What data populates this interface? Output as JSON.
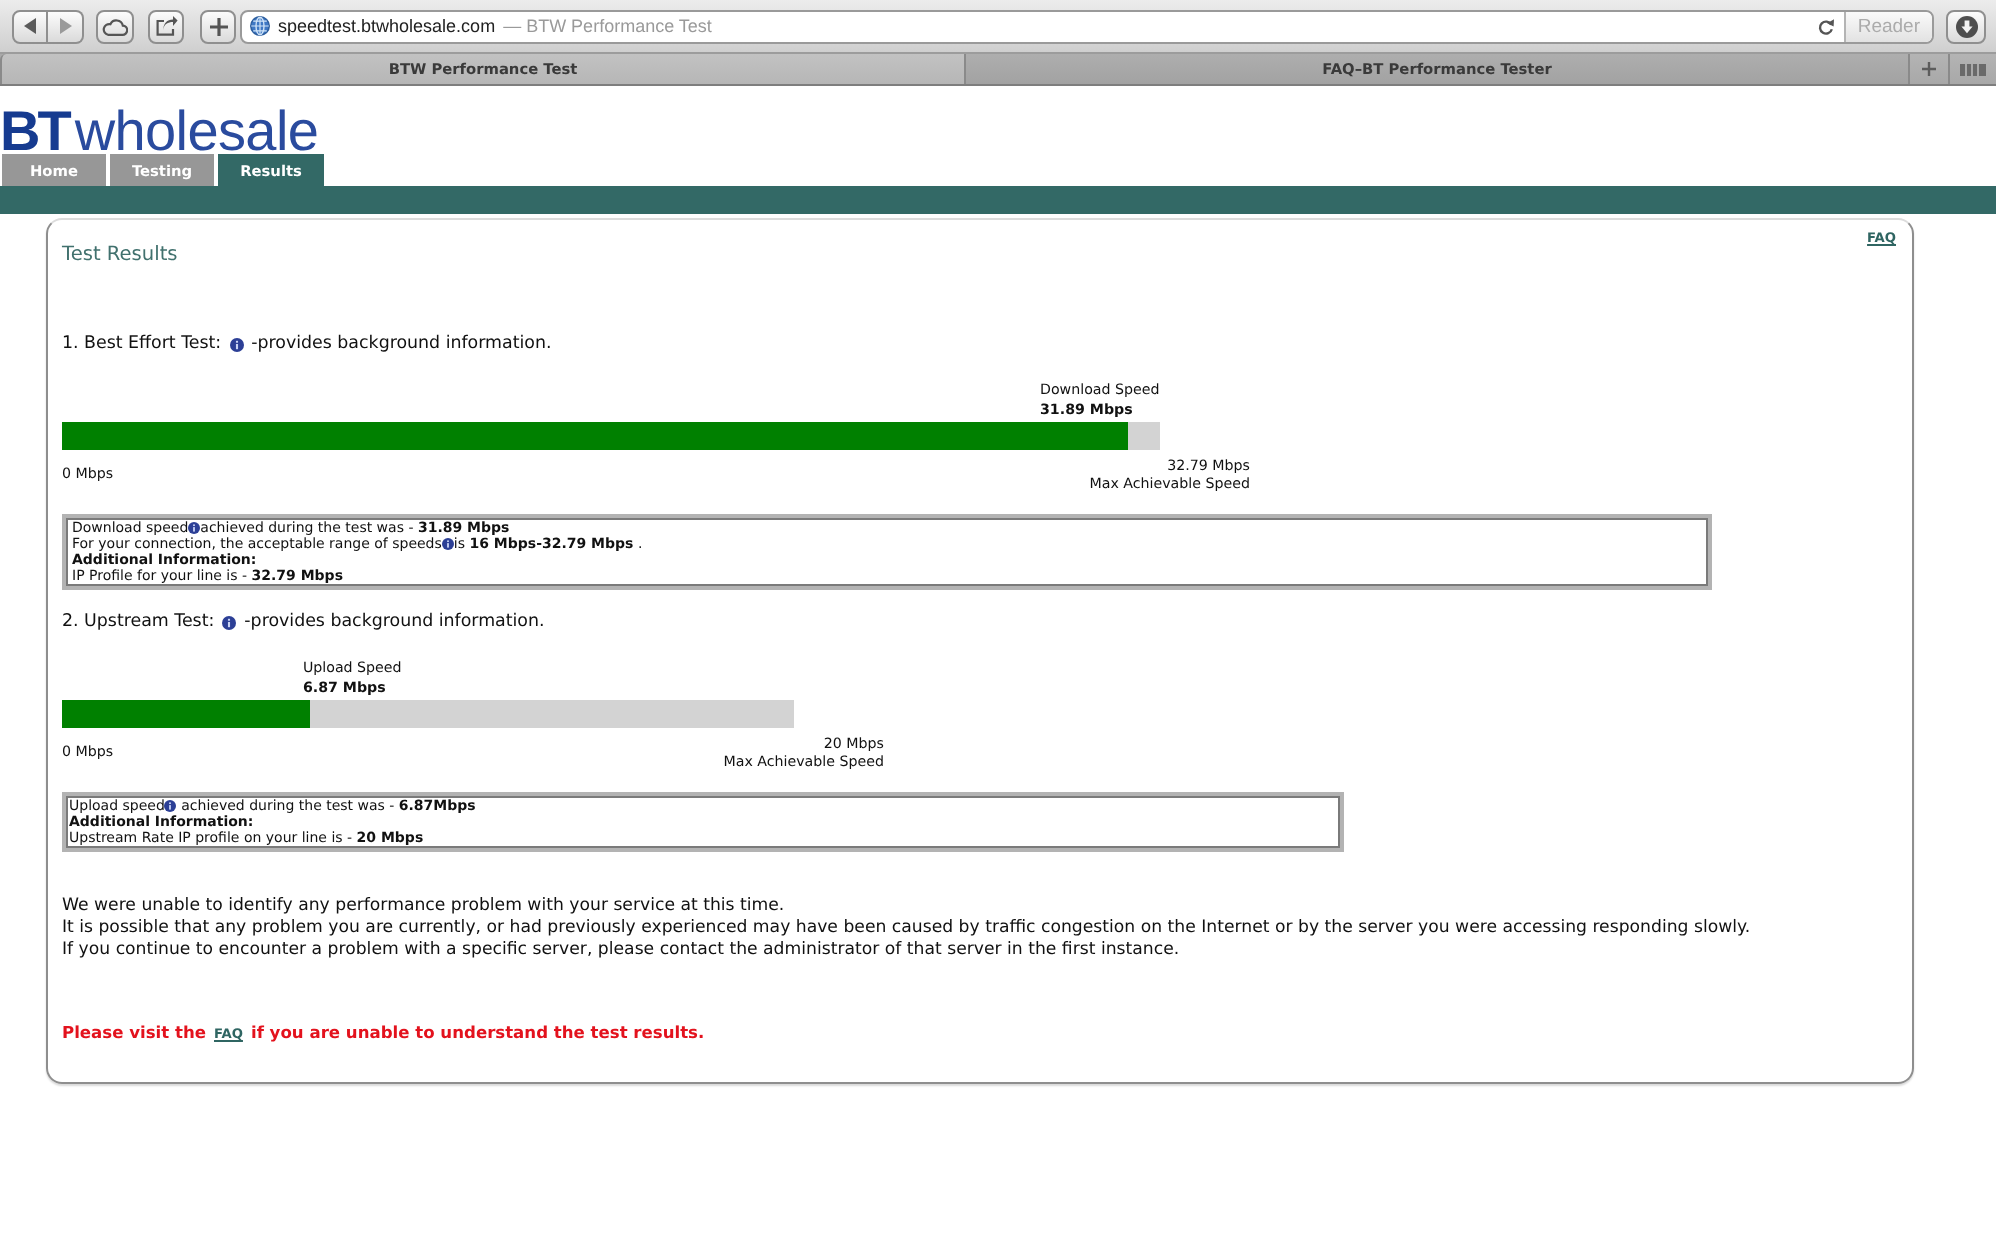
{
  "browser": {
    "address": {
      "url": "speedtest.btwholesale.com",
      "page_title": "— BTW Performance Test"
    },
    "reader_button": "Reader",
    "tabs": [
      {
        "label": "BTW Performance Test",
        "selected": true
      },
      {
        "label": "FAQ–BT Performance Tester",
        "selected": false
      }
    ]
  },
  "header": {
    "logo": "**BT**wholesale",
    "nav": [
      {
        "label": "Home",
        "selected": false
      },
      {
        "label": "Testing",
        "selected": false
      },
      {
        "label": "Results",
        "selected": true
      }
    ]
  },
  "panel": {
    "title": "Test Results",
    "faq_link": "FAQ",
    "tests": [
      {
        "heading": "1. Best Effort Test:",
        "note": "-provides background information.",
        "speed_label": "Download Speed",
        "speed": "31.89 Mbps",
        "level": 0.97,
        "min_label": "0 Mbps",
        "max_value": "32.79 Mbps",
        "max_label": "Max Achievable Speed",
        "details": [
          {
            "kind": "info",
            "text": "Download speed",
            "after": "achieved during the test was - **31.89 Mbps**"
          },
          {
            "kind": "info",
            "text": "For your connection, the acceptable range of speeds",
            "after": "is **16 Mbps-32.79 Mbps** ."
          },
          {
            "kind": "heading",
            "text": "Additional Information:"
          },
          {
            "kind": "text",
            "text": "IP Profile for your line is - **32.79 Mbps**"
          }
        ]
      },
      {
        "heading": "2. Upstream Test:",
        "note": "-provides background information.",
        "speed_label": "Upload Speed",
        "speed": "6.87 Mbps",
        "level": 0.34,
        "min_label": "0 Mbps",
        "max_value": "20 Mbps",
        "max_label": "Max Achievable Speed",
        "details": [
          {
            "kind": "info",
            "text": "Upload speed",
            "after": " achieved during the test was - **6.87Mbps**"
          },
          {
            "kind": "heading",
            "text": "Additional Information:"
          },
          {
            "kind": "text",
            "text": "Upstream Rate IP profile on your line is - **20 Mbps**"
          }
        ]
      }
    ],
    "messages": [
      "We were unable to identify any performance problem with your service at this time.",
      "It is possible that any problem you are currently, or had previously experienced may have been caused by traffic congestion on the Internet or by the server you were accessing responding slowly.",
      "If you continue to encounter a problem with a specific server, please contact the administrator of that server in the first instance."
    ],
    "notice": {
      "before": "Please visit the",
      "link": "FAQ",
      "after": "if you are unable to understand the test results."
    }
  }
}
